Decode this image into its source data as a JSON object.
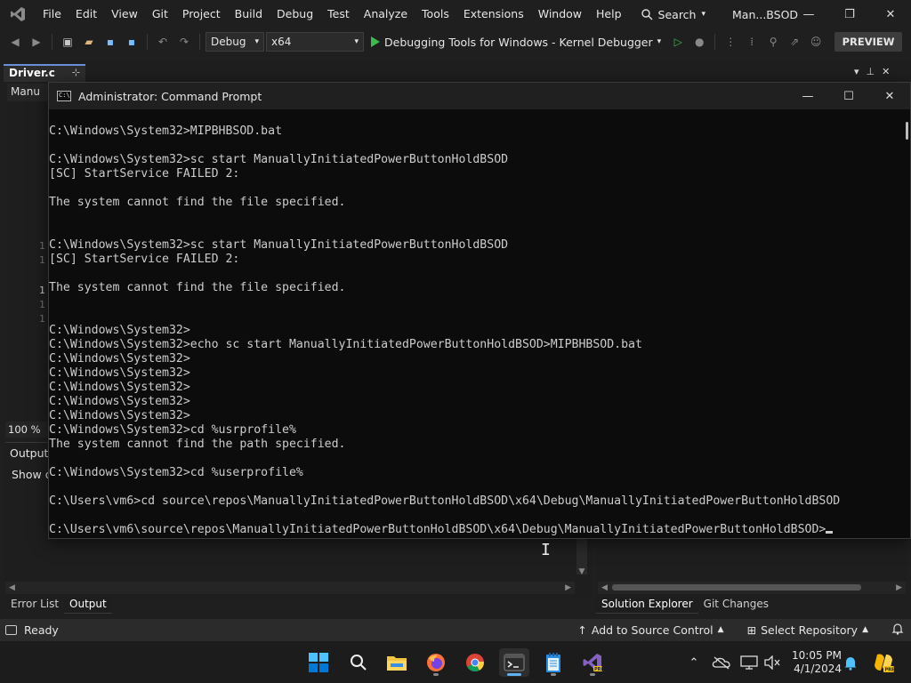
{
  "menu": {
    "items": [
      "File",
      "Edit",
      "View",
      "Git",
      "Project",
      "Build",
      "Debug",
      "Test",
      "Analyze",
      "Tools",
      "Extensions",
      "Window",
      "Help"
    ],
    "search_label": "Search",
    "solution_name": "Man...BSOD"
  },
  "toolbar": {
    "config": "Debug",
    "platform": "x64",
    "run_target": "Debugging Tools for Windows - Kernel Debugger",
    "preview_label": "PREVIEW"
  },
  "editor": {
    "doc_tab": "Driver.c",
    "nav_combo": "Manu",
    "line_numbers": [
      "1",
      "1",
      "1",
      "1",
      "1"
    ],
    "zoom": "100 %"
  },
  "output": {
    "title": "Output",
    "show_output_from": "Show o"
  },
  "bottom_tabs_left": [
    "Error List",
    "Output"
  ],
  "bottom_tabs_right": [
    "Solution Explorer",
    "Git Changes"
  ],
  "status": {
    "ready": "Ready",
    "add_source_control": "Add to Source Control",
    "select_repository": "Select Repository"
  },
  "cmd": {
    "title": "Administrator: Command Prompt",
    "lines": [
      "C:\\Windows\\System32>MIPBHBSOD.bat",
      "",
      "C:\\Windows\\System32>sc start ManuallyInitiatedPowerButtonHoldBSOD",
      "[SC] StartService FAILED 2:",
      "",
      "The system cannot find the file specified.",
      "",
      "",
      "C:\\Windows\\System32>sc start ManuallyInitiatedPowerButtonHoldBSOD",
      "[SC] StartService FAILED 2:",
      "",
      "The system cannot find the file specified.",
      "",
      "",
      "C:\\Windows\\System32>",
      "C:\\Windows\\System32>echo sc start ManuallyInitiatedPowerButtonHoldBSOD>MIPBHBSOD.bat",
      "C:\\Windows\\System32>",
      "C:\\Windows\\System32>",
      "C:\\Windows\\System32>",
      "C:\\Windows\\System32>",
      "C:\\Windows\\System32>",
      "C:\\Windows\\System32>cd %usrprofile%",
      "The system cannot find the path specified.",
      "",
      "C:\\Windows\\System32>cd %userprofile%",
      "",
      "C:\\Users\\vm6>cd source\\repos\\ManuallyInitiatedPowerButtonHoldBSOD\\x64\\Debug\\ManuallyInitiatedPowerButtonHoldBSOD",
      "",
      "C:\\Users\\vm6\\source\\repos\\ManuallyInitiatedPowerButtonHoldBSOD\\x64\\Debug\\ManuallyInitiatedPowerButtonHoldBSOD>"
    ]
  },
  "taskbar": {
    "apps": [
      "windows-start-icon",
      "search-icon",
      "file-explorer-icon",
      "firefox-icon",
      "chrome-icon",
      "terminal-icon",
      "notepad-icon",
      "visual-studio-icon"
    ],
    "time": "10:05 PM",
    "date": "4/1/2024"
  },
  "colors": {
    "accent": "#5fb2f2",
    "run_green": "#3fb950",
    "vs_purple": "#8661c5",
    "console_bg": "#0c0c0c",
    "console_fg": "#cccccc"
  }
}
